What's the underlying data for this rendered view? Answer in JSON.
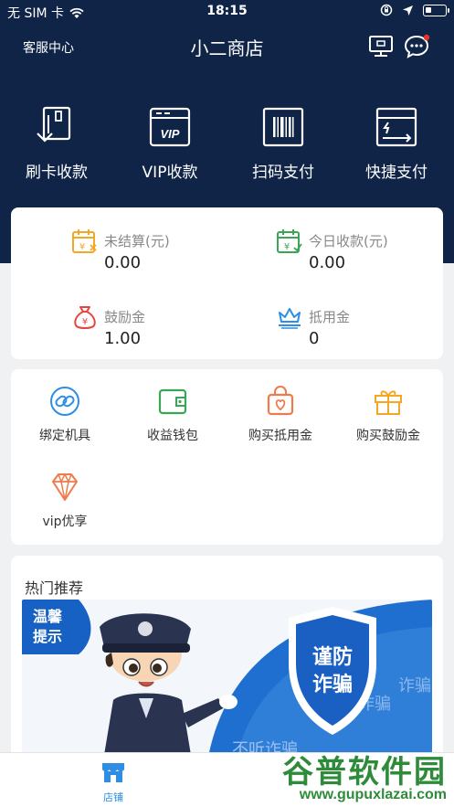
{
  "status_bar": {
    "carrier": "无 SIM 卡",
    "time": "18:15"
  },
  "header": {
    "left_link": "客服中心",
    "title": "小二商店"
  },
  "quick_actions": [
    {
      "label": "刷卡收款",
      "icon": "card-swipe-icon"
    },
    {
      "label": "VIP收款",
      "icon": "vip-card-icon",
      "badge": "VIP"
    },
    {
      "label": "扫码支付",
      "icon": "barcode-scan-icon"
    },
    {
      "label": "快捷支付",
      "icon": "quick-pay-icon"
    }
  ],
  "stats": [
    {
      "label": "未结算(元)",
      "value": "0.00",
      "icon": "calendar-yen-icon",
      "color": "#f5a623"
    },
    {
      "label": "今日收款(元)",
      "value": "0.00",
      "icon": "calendar-check-icon",
      "color": "#3aa655"
    },
    {
      "label": "鼓励金",
      "value": "1.00",
      "icon": "money-bag-icon",
      "color": "#e6463c"
    },
    {
      "label": "抵用金",
      "value": "0",
      "icon": "crown-icon",
      "color": "#2d8ee6"
    }
  ],
  "tools": [
    {
      "label": "绑定机具",
      "icon": "link-icon",
      "color": "#2d8ee6"
    },
    {
      "label": "收益钱包",
      "icon": "wallet-icon",
      "color": "#3aa655"
    },
    {
      "label": "购买抵用金",
      "icon": "shopping-bag-icon",
      "color": "#f07a4a"
    },
    {
      "label": "购买鼓励金",
      "icon": "gift-icon",
      "color": "#f5a623"
    },
    {
      "label": "vip优享",
      "icon": "diamond-icon",
      "color": "#f07a4a"
    }
  ],
  "hot": {
    "title": "热门推荐",
    "banner": {
      "tag_line1": "温馨",
      "tag_line2": "提示",
      "shield_line1": "谨防",
      "shield_line2": "诈骗",
      "background_words": [
        "不听诈骗",
        "诈骗",
        "诈骗"
      ]
    }
  },
  "tabbar": {
    "tabs": [
      {
        "label": "店铺",
        "icon": "store-icon",
        "active": true
      }
    ]
  },
  "watermark": {
    "line1": "谷普软件园",
    "line2": "www.gupuxlazai.com"
  },
  "colors": {
    "header_bg": "#0f2447",
    "accent": "#2d8ee6",
    "page_bg": "#f0f1f3"
  }
}
